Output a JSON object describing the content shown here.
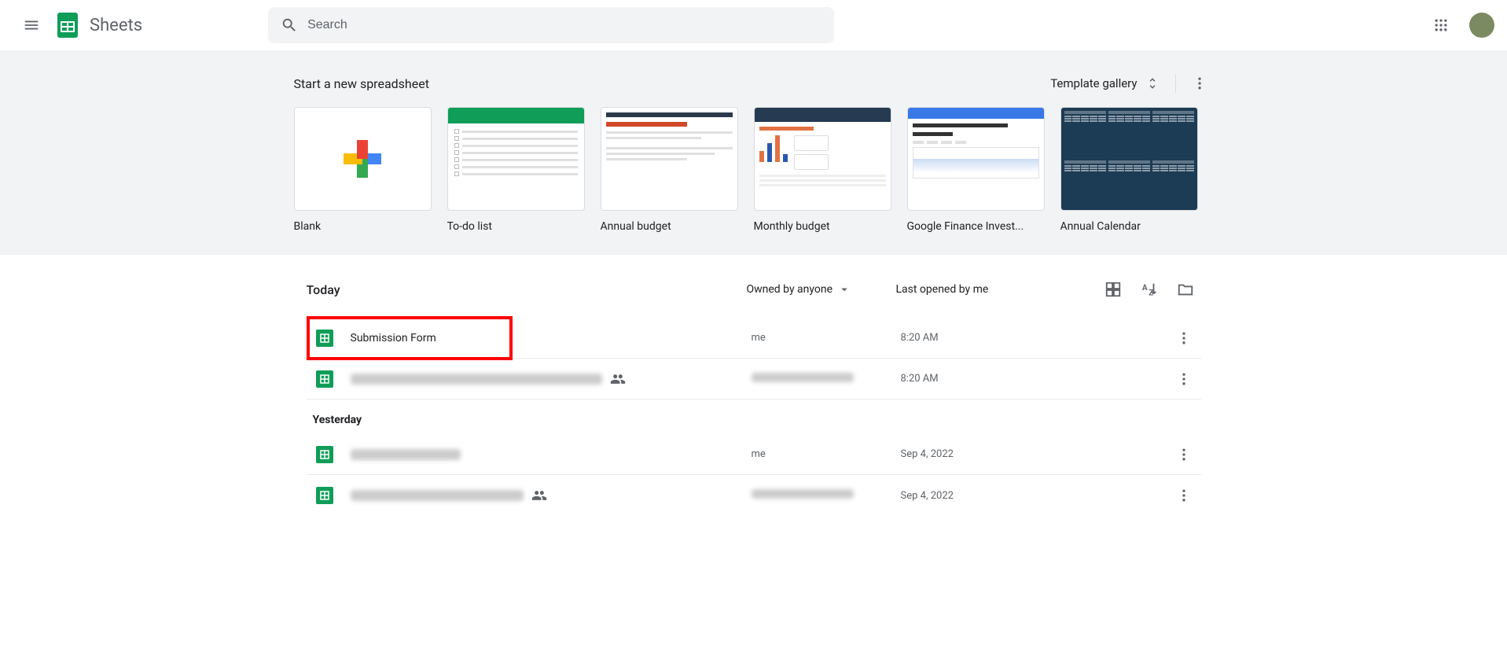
{
  "app": {
    "name": "Sheets"
  },
  "search": {
    "placeholder": "Search"
  },
  "templates": {
    "heading": "Start a new spreadsheet",
    "gallery_label": "Template gallery",
    "items": [
      {
        "name": "Blank"
      },
      {
        "name": "To-do list"
      },
      {
        "name": "Annual budget"
      },
      {
        "name": "Monthly budget"
      },
      {
        "name": "Google Finance Invest..."
      },
      {
        "name": "Annual Calendar"
      }
    ]
  },
  "docs": {
    "owned_filter_label": "Owned by anyone",
    "sort_label": "Last opened by me",
    "groups": [
      {
        "heading": "Today",
        "files": [
          {
            "name": "Submission Form",
            "owner": "me",
            "time": "8:20 AM",
            "highlighted": true,
            "shared": false,
            "blurred": false
          },
          {
            "name": "",
            "owner": "",
            "time": "8:20 AM",
            "highlighted": false,
            "shared": true,
            "blurred": true
          }
        ]
      },
      {
        "heading": "Yesterday",
        "files": [
          {
            "name": "",
            "owner": "me",
            "time": "Sep 4, 2022",
            "highlighted": false,
            "shared": false,
            "blurred": true,
            "owner_blurred": false
          },
          {
            "name": "",
            "owner": "",
            "time": "Sep 4, 2022",
            "highlighted": false,
            "shared": true,
            "blurred": true
          }
        ]
      }
    ]
  }
}
